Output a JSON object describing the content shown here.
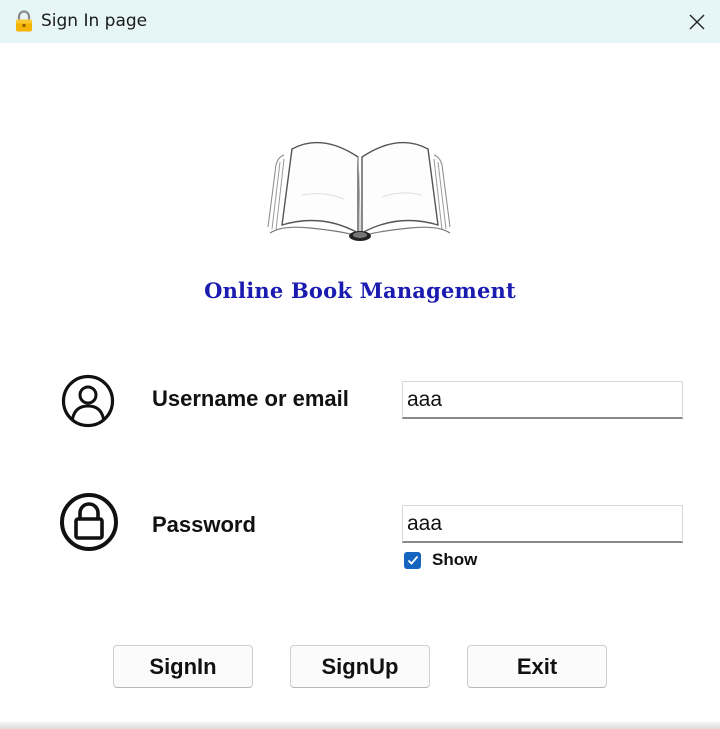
{
  "window": {
    "title": "Sign In page",
    "title_icon": "lock-icon",
    "close_icon": "close-icon"
  },
  "app": {
    "title": "Online Book Management",
    "title_color": "#1b1bb0",
    "logo": "open-book-icon"
  },
  "form": {
    "username": {
      "label": "Username or email",
      "value": "aaa",
      "icon": "user-icon"
    },
    "password": {
      "label": "Password",
      "value": "aaa",
      "icon": "lock-icon"
    },
    "show_password": {
      "label": "Show",
      "checked": true,
      "accent": "#1565c0"
    }
  },
  "buttons": {
    "signin": "SignIn",
    "signup": "SignUp",
    "exit": "Exit"
  }
}
